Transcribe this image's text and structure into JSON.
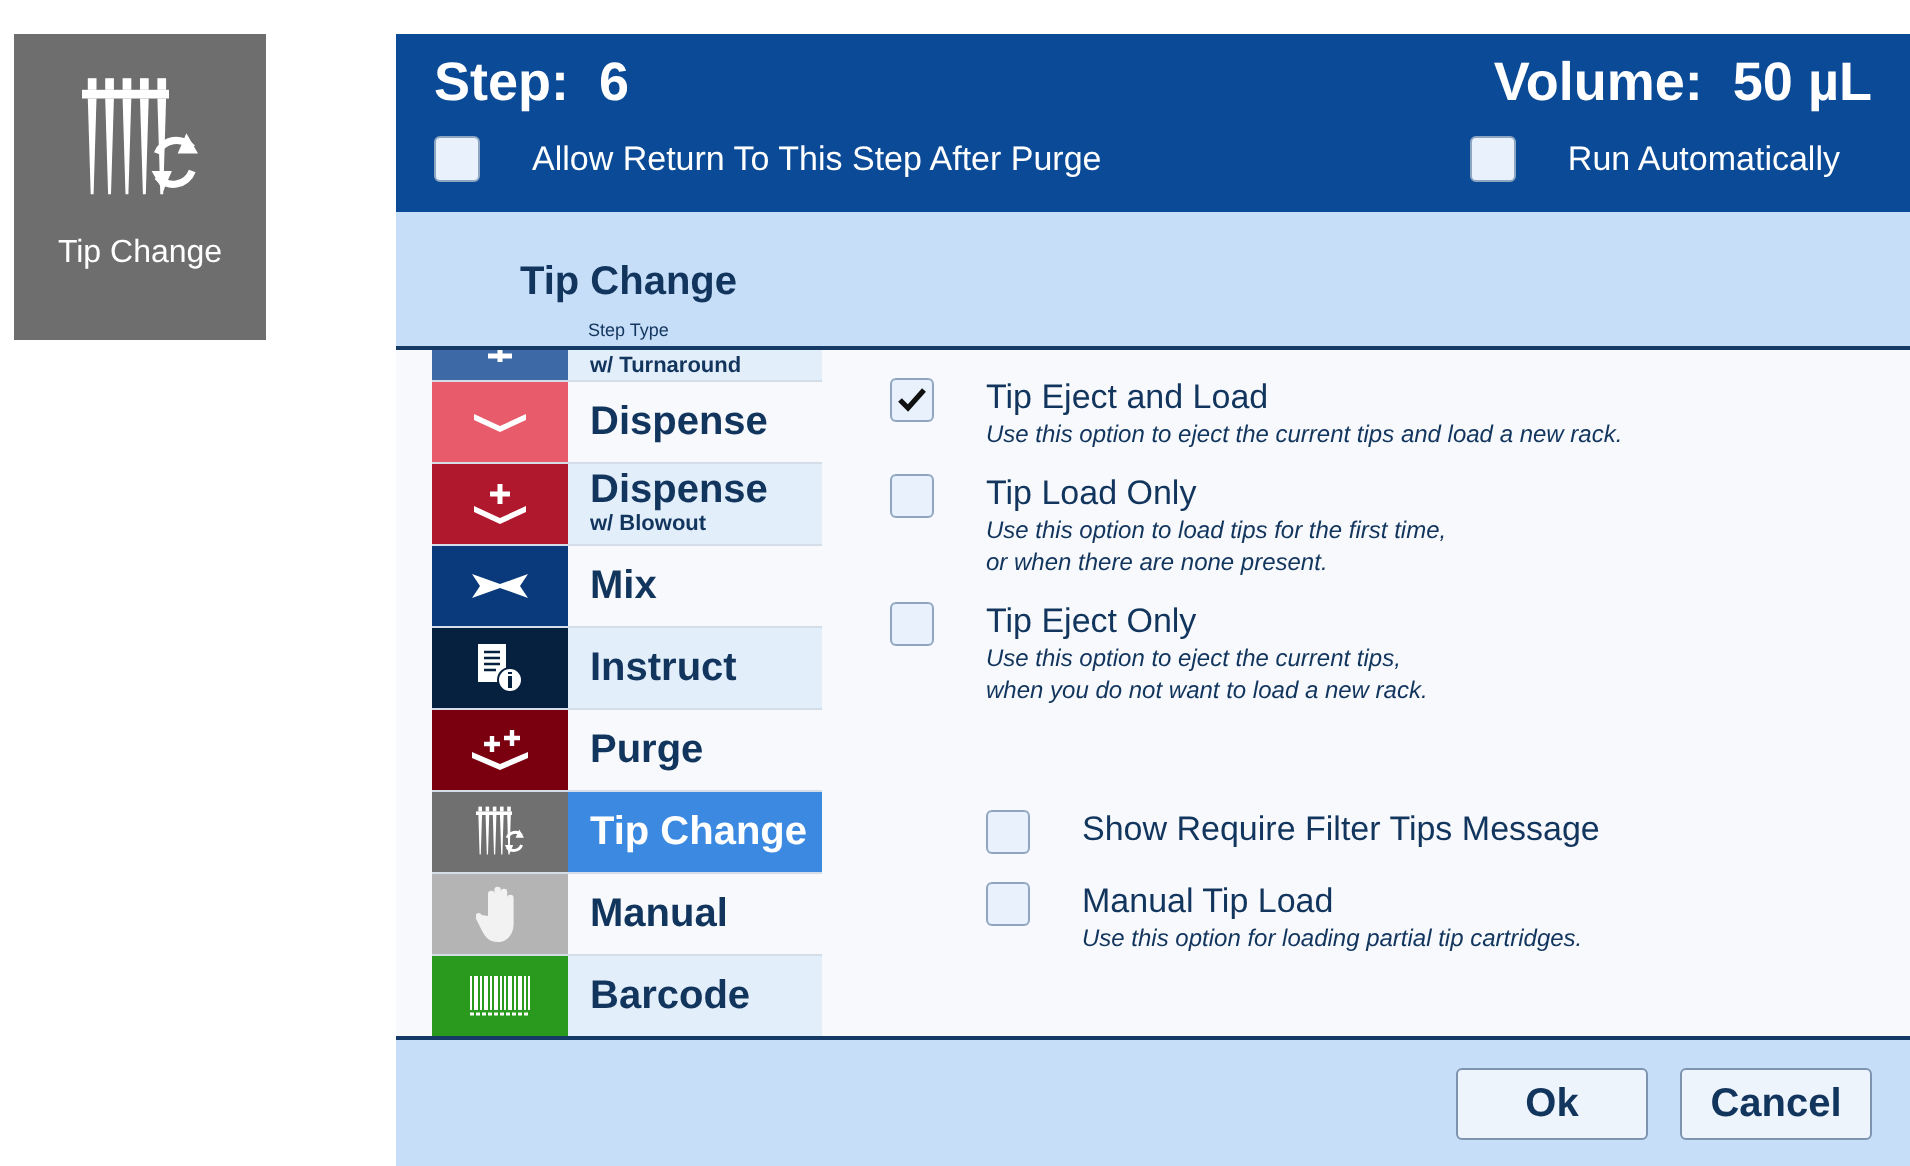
{
  "tile": {
    "label": "Tip Change"
  },
  "header": {
    "step_label": "Step:",
    "step_value": "6",
    "volume_label": "Volume:",
    "volume_value": "50 µL"
  },
  "header_options": [
    {
      "label": "Allow Return To This Step After Purge",
      "checked": false
    },
    {
      "label": "Run Automatically",
      "checked": false
    }
  ],
  "title": "Tip Change",
  "step_type_caption": "Step Type",
  "step_types": [
    {
      "kind": "turnaround",
      "sublabel": "w/ Turnaround",
      "color": "#3d6aa6",
      "selected": false
    },
    {
      "kind": "dispense",
      "label": "Dispense",
      "color": "#e85b6a",
      "selected": false
    },
    {
      "kind": "blowout",
      "label": "Dispense",
      "sublabel": "w/ Blowout",
      "color": "#b0182e",
      "selected": false
    },
    {
      "kind": "mix",
      "label": "Mix",
      "color": "#0a3a7c",
      "selected": false
    },
    {
      "kind": "instruct",
      "label": "Instruct",
      "color": "#06213f",
      "selected": false
    },
    {
      "kind": "purge",
      "label": "Purge",
      "color": "#7a0010",
      "selected": false
    },
    {
      "kind": "tipchange",
      "label": "Tip Change",
      "color": "#707070",
      "selected": true
    },
    {
      "kind": "manual",
      "label": "Manual",
      "color": "#b4b4b4",
      "selected": false
    },
    {
      "kind": "barcode",
      "label": "Barcode",
      "color": "#2a9a1e",
      "selected": false
    }
  ],
  "options": [
    {
      "label": "Tip Eject and Load",
      "description": "Use this option to eject the current tips and load a new rack.",
      "checked": true
    },
    {
      "label": "Tip Load Only",
      "description": "Use this option to load tips for the first time,\nor when there are none present.",
      "checked": false
    },
    {
      "label": "Tip Eject Only",
      "description": "Use this option to eject the current tips,\nwhen you do not want to load a new rack.",
      "checked": false
    }
  ],
  "extra_options": [
    {
      "label": "Show Require Filter Tips Message",
      "checked": false
    },
    {
      "label": "Manual Tip Load",
      "description": "Use this option for loading partial tip cartridges.",
      "checked": false
    }
  ],
  "buttons": [
    "Ok",
    "Cancel"
  ]
}
